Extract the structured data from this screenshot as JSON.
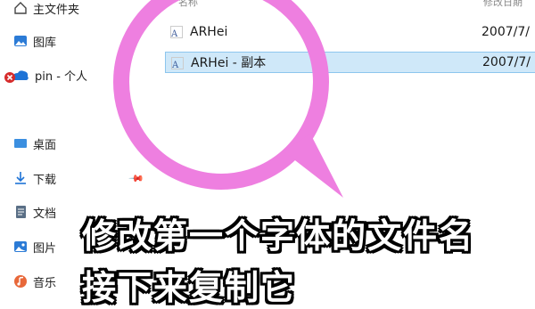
{
  "sidebar": {
    "items": [
      {
        "label": "主文件夹",
        "icon": "home-icon"
      },
      {
        "label": "图库",
        "icon": "gallery-icon"
      },
      {
        "label": "pin - 个人",
        "icon": "onedrive-cloud-icon"
      },
      {
        "label": "桌面",
        "icon": "desktop-icon"
      },
      {
        "label": "下载",
        "icon": "download-icon"
      },
      {
        "label": "文档",
        "icon": "document-icon"
      },
      {
        "label": "图片",
        "icon": "pictures-icon"
      },
      {
        "label": "音乐",
        "icon": "music-icon"
      }
    ]
  },
  "file_list": {
    "header": {
      "name": "名称",
      "date": "修改日期"
    },
    "rows": [
      {
        "name": "ARHei",
        "date": "2007/7/",
        "selected": false
      },
      {
        "name": "ARHei - 副本",
        "date": "2007/7/",
        "selected": true
      }
    ]
  },
  "caption": {
    "line1": "修改第一个字体的文件名",
    "line2": "接下来复制它"
  },
  "colors": {
    "selection_bg": "#cfe8f9",
    "selection_border": "#8dc6ee",
    "magnifier_ring": "#ee7fe0",
    "caption_text": "#ffffff"
  }
}
